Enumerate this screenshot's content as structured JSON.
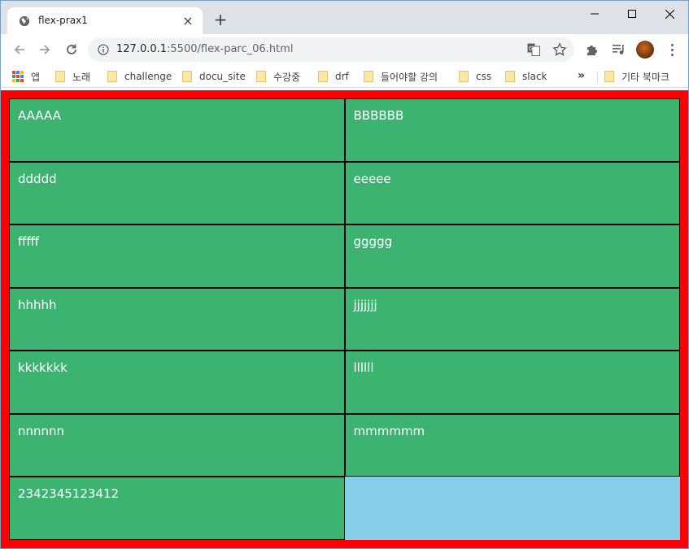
{
  "tab": {
    "title": "flex-prax1"
  },
  "address_bar": {
    "url_host": "127.0.0.1",
    "url_rest": ":5500/flex-parc_06.html"
  },
  "bookmarks": {
    "apps": "앱",
    "items": [
      "노래",
      "challenge",
      "docu_site",
      "수강중",
      "drf",
      "들어야할 강의",
      "css",
      "slack"
    ],
    "more": "»",
    "other": "기타 북마크"
  },
  "colors": {
    "page_bg": "#ff0000",
    "cell_bg": "#3cb371",
    "empty_bg": "#87ceeb",
    "cell_text": "#ffffff"
  },
  "cells": [
    "AAAAA",
    "BBBBBB",
    "ddddd",
    "eeeee",
    "fffff",
    "ggggg",
    "hhhhh",
    "jjjjjjj",
    "kkkkkkk",
    "llllll",
    "nnnnnn",
    "mmmmmm",
    "2342345123412"
  ]
}
